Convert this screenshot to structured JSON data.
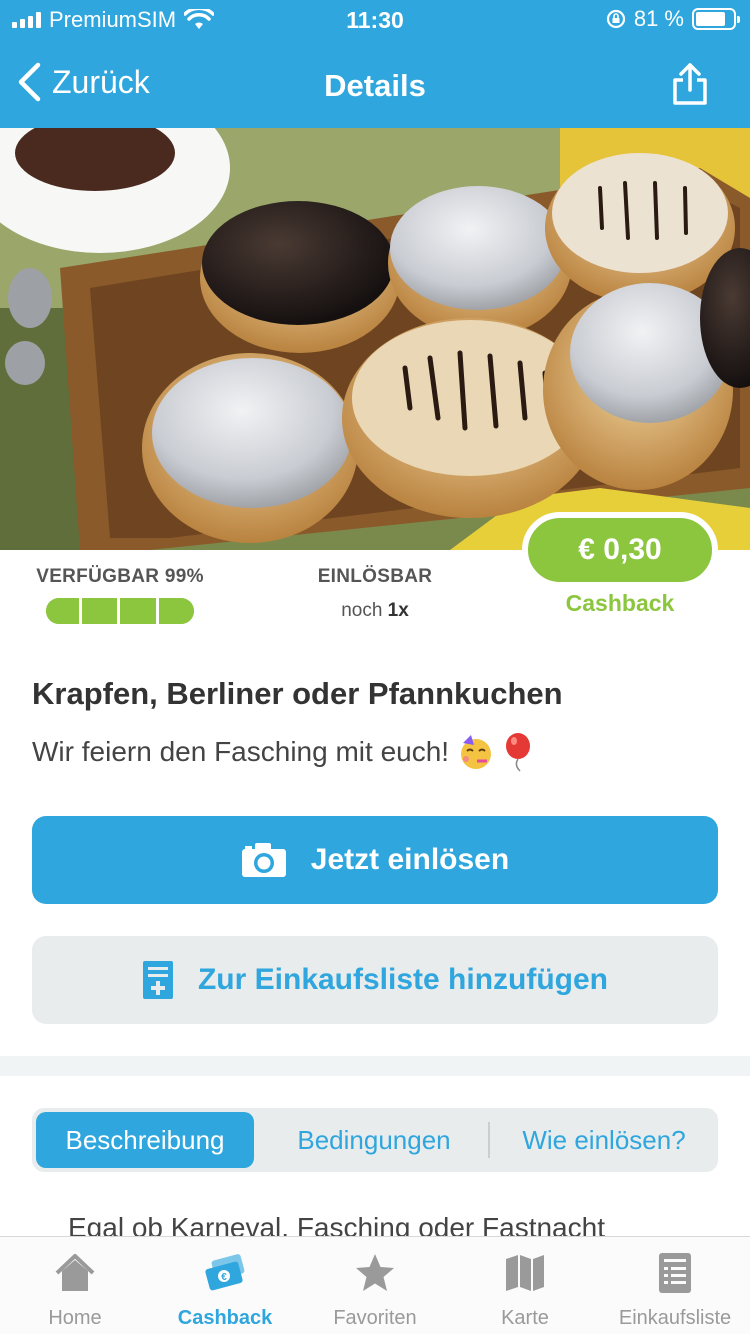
{
  "status_bar": {
    "carrier": "PremiumSIM",
    "time": "11:30",
    "battery": "81 %"
  },
  "nav": {
    "back_label": "Zurück",
    "title": "Details"
  },
  "stats": {
    "available_label": "VERFÜGBAR 99%",
    "available_fraction": 0.99,
    "redeemable_label": "EINLÖSBAR",
    "redeemable_prefix": "noch",
    "redeemable_count": "1x"
  },
  "offer": {
    "price": "€ 0,30",
    "price_caption": "Cashback",
    "title": "Krapfen, Berliner oder Pfannkuchen",
    "subtitle": "Wir feiern den Fasching mit euch!"
  },
  "actions": {
    "redeem_label": "Jetzt einlösen",
    "add_list_label": "Zur Einkaufsliste hinzufügen"
  },
  "segments": {
    "items": [
      "Beschreibung",
      "Bedingungen",
      "Wie einlösen?"
    ],
    "active": "Beschreibung"
  },
  "description": "Egal ob Karneval, Fasching oder Fastnacht",
  "tabbar": {
    "items": [
      {
        "label": "Home",
        "icon": "home-icon"
      },
      {
        "label": "Cashback",
        "icon": "cashback-icon"
      },
      {
        "label": "Favoriten",
        "icon": "star-icon"
      },
      {
        "label": "Karte",
        "icon": "map-icon"
      },
      {
        "label": "Einkaufsliste",
        "icon": "list-icon"
      }
    ],
    "active": "Cashback"
  },
  "colors": {
    "brand_blue": "#2fa6dd",
    "cashback_green": "#8cc63f",
    "light_gray": "#e8eced"
  }
}
